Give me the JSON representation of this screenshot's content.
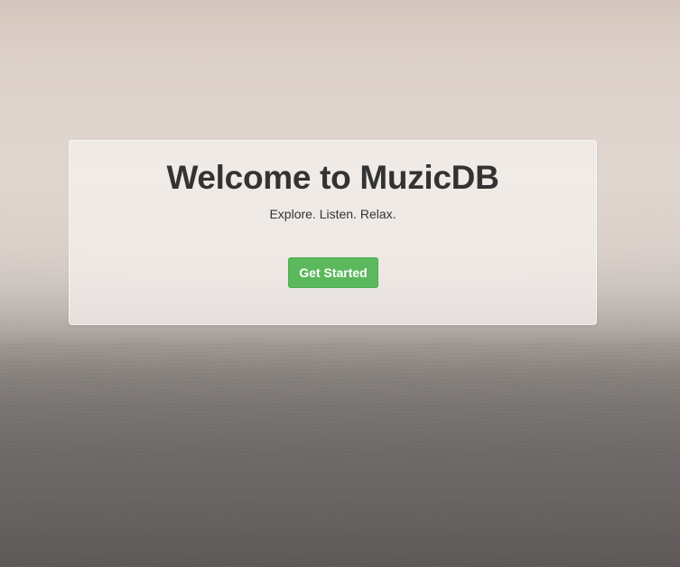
{
  "hero": {
    "title": "Welcome to MuzicDB",
    "tagline": "Explore. Listen. Relax.",
    "cta_label": "Get Started"
  },
  "colors": {
    "cta_background": "#5cb85c",
    "cta_text": "#ffffff",
    "title_text": "#333333"
  }
}
